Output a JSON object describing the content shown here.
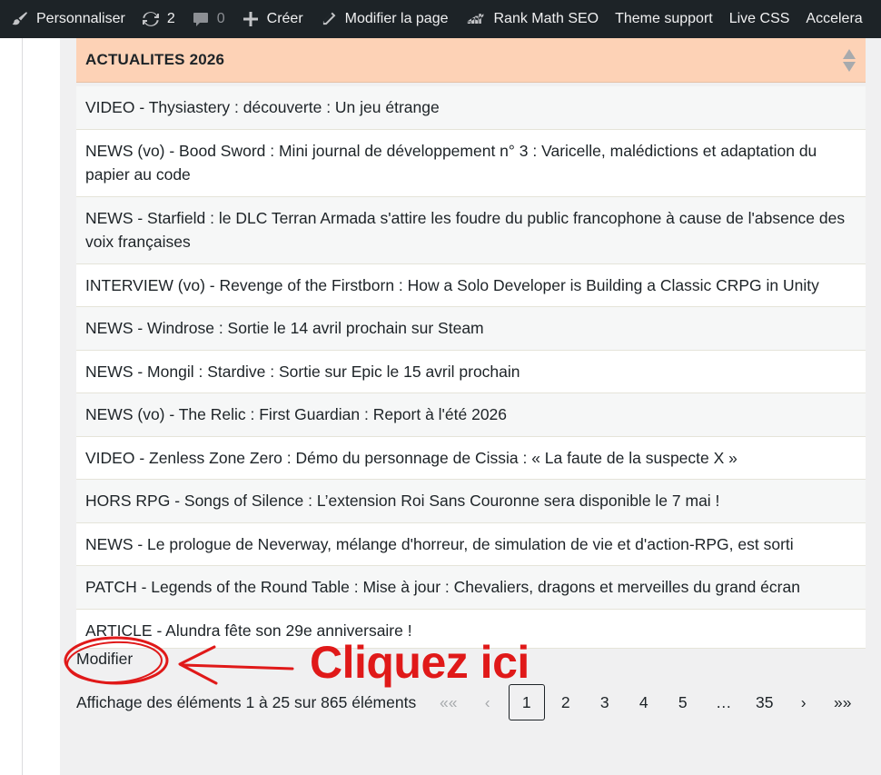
{
  "adminbar": {
    "items": [
      {
        "icon": "brush-icon",
        "label": "Personnaliser"
      },
      {
        "icon": "refresh-icon",
        "label": "2"
      },
      {
        "icon": "comment-icon",
        "label": "0"
      },
      {
        "icon": "plus-icon",
        "label": "Créer"
      },
      {
        "icon": "pencil-icon",
        "label": "Modifier la page"
      },
      {
        "icon": "rank-math-icon",
        "label": "Rank Math SEO"
      },
      {
        "label": "Theme support"
      },
      {
        "label": "Live CSS"
      },
      {
        "label": "Accelera"
      }
    ]
  },
  "widget": {
    "title": "ACTUALITES 2026",
    "items": [
      "VIDEO - Thysiastery : découverte : Un jeu étrange",
      "NEWS (vo) - Bood Sword : Mini journal de développement n° 3 : Varicelle, malédictions et adaptation du papier au code",
      "NEWS - Starfield : le DLC Terran Armada s'attire les foudre du public francophone à cause de l'absence des voix françaises",
      "INTERVIEW (vo) - Revenge of the Firstborn : How a Solo Developer is Building a Classic CRPG in Unity",
      "NEWS - Windrose : Sortie le 14 avril prochain sur Steam",
      "NEWS - Mongil : Stardive : Sortie sur Epic le 15 avril prochain",
      "NEWS (vo) - The Relic : First Guardian : Report à l'été 2026",
      "VIDEO - Zenless Zone Zero : Démo du personnage de Cissia : « La faute de la suspecte X »",
      "HORS RPG - Songs of Silence : L’extension Roi Sans Couronne sera disponible le 7 mai !",
      "NEWS - Le prologue de Neverway, mélange d'horreur, de simulation de vie et d'action-RPG, est sorti",
      "PATCH - Legends of the Round Table : Mise à jour : Chevaliers, dragons et merveilles du grand écran",
      "ARTICLE - Alundra fête son 29e anniversaire !"
    ],
    "edit_link": "Modifier"
  },
  "annotation": {
    "text": "Cliquez ici",
    "color": "#e01919"
  },
  "pagination": {
    "info": "Affichage des éléments 1 à 25 sur 865 éléments",
    "first": "««",
    "prev": "‹",
    "pages": [
      "1",
      "2",
      "3",
      "4",
      "5"
    ],
    "current": "1",
    "ellipsis": "…",
    "last_page": "35",
    "next": "›",
    "last": "»»"
  },
  "colors": {
    "adminbar_bg": "#1d2327",
    "widget_header_bg": "#fdd2b6",
    "page_bg": "#f0f0f1"
  }
}
